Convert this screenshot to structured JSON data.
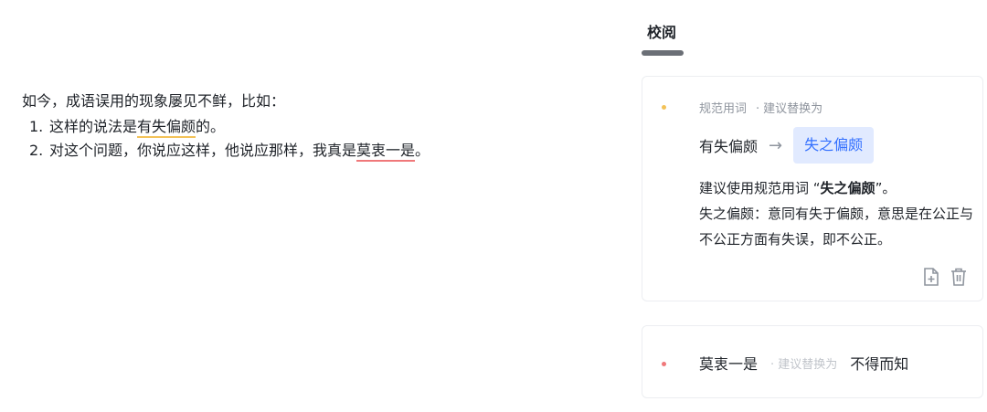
{
  "document": {
    "intro": "如今，成语误用的现象屡见不鲜，比如：",
    "items": [
      {
        "num": "1.",
        "before": "这样的说法是",
        "mark": "有失偏颇",
        "after": "的。"
      },
      {
        "num": "2.",
        "before": "对这个问题，你说应这样，他说应那样，我真是",
        "mark": "莫衷一是",
        "after": "。"
      }
    ]
  },
  "panel": {
    "title": "校阅",
    "card1": {
      "type_label": "规范用词",
      "suggest_label": "建议替换为",
      "original": "有失偏颇",
      "arrow": "→",
      "suggestion": "失之偏颇",
      "desc_prefix": "建议使用规范用词 “",
      "desc_bold": "失之偏颇",
      "desc_suffix": "”。",
      "explain": "失之偏颇：意同有失于偏颇，意思是在公正与不公正方面有失误，即不公正。"
    },
    "card2": {
      "original": "莫衷一是",
      "suggest_label": "建议替换为",
      "suggestion": "不得而知"
    }
  },
  "colors": {
    "warn": "#f3c258",
    "error": "#f0787a",
    "accent": "#3370ff",
    "accent_bg": "#e1eaff"
  },
  "icons": [
    "add-document-icon",
    "trash-icon",
    "arrow-right-icon"
  ]
}
